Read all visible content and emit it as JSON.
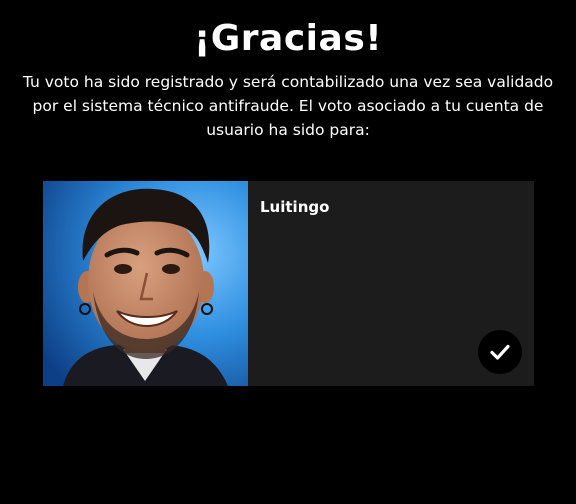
{
  "header": {
    "title": "¡Gracias!"
  },
  "confirmation": {
    "message": "Tu voto ha sido registrado y será contabilizado una vez sea validado por el sistema técnico antifraude. El voto asociado a tu cuenta de usuario ha sido para:"
  },
  "selected_candidate": {
    "name": "Luitingo",
    "selected": true,
    "icon": "check-icon"
  },
  "colors": {
    "background": "#000000",
    "card": "#1c1c1c",
    "text": "#ffffff",
    "photo_backdrop": "#2f8fe0"
  }
}
